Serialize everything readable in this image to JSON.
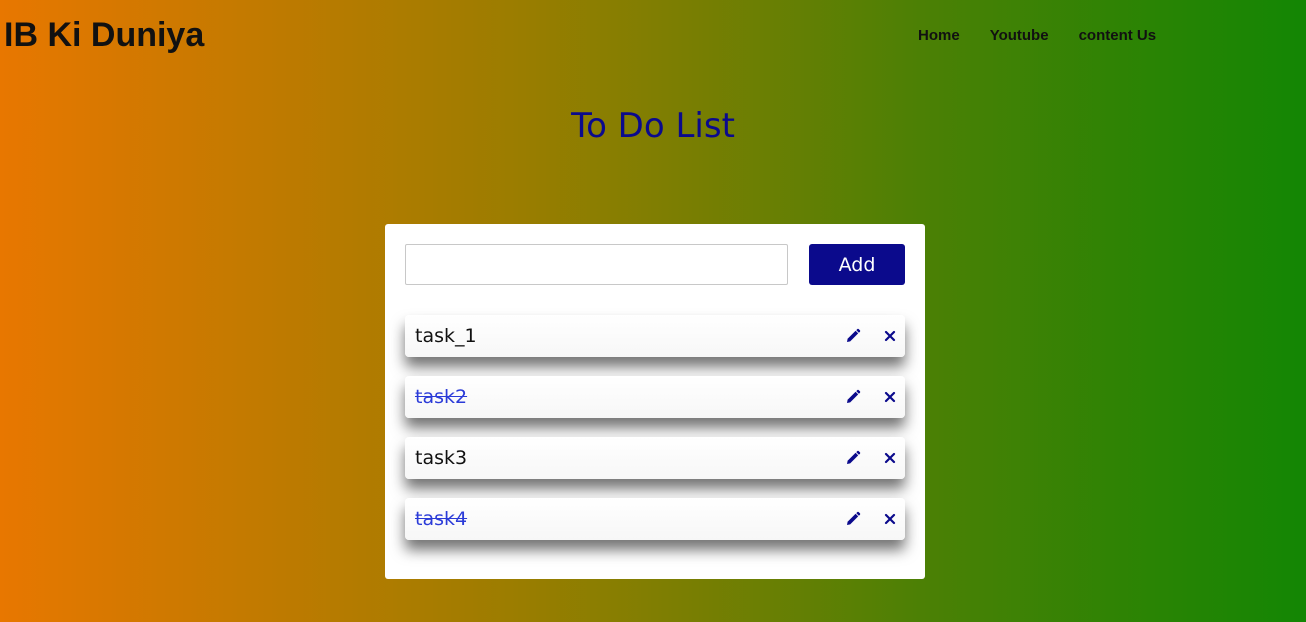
{
  "header": {
    "brand": "IB Ki Duniya",
    "nav": [
      "Home",
      "Youtube",
      "content Us"
    ]
  },
  "main": {
    "title": "To Do List",
    "input": {
      "value": "",
      "placeholder": ""
    },
    "add_label": "Add",
    "tasks": [
      {
        "text": "task_1",
        "completed": false
      },
      {
        "text": "task2",
        "completed": true
      },
      {
        "text": "task3",
        "completed": false
      },
      {
        "text": "task4",
        "completed": true
      }
    ],
    "task_icons": [
      "pencil-icon",
      "close-icon"
    ]
  },
  "colors": {
    "accent": "#0b0a8c",
    "completed_text": "#2b3bd8",
    "gradient_left": "#e87700",
    "gradient_right": "#138604"
  }
}
